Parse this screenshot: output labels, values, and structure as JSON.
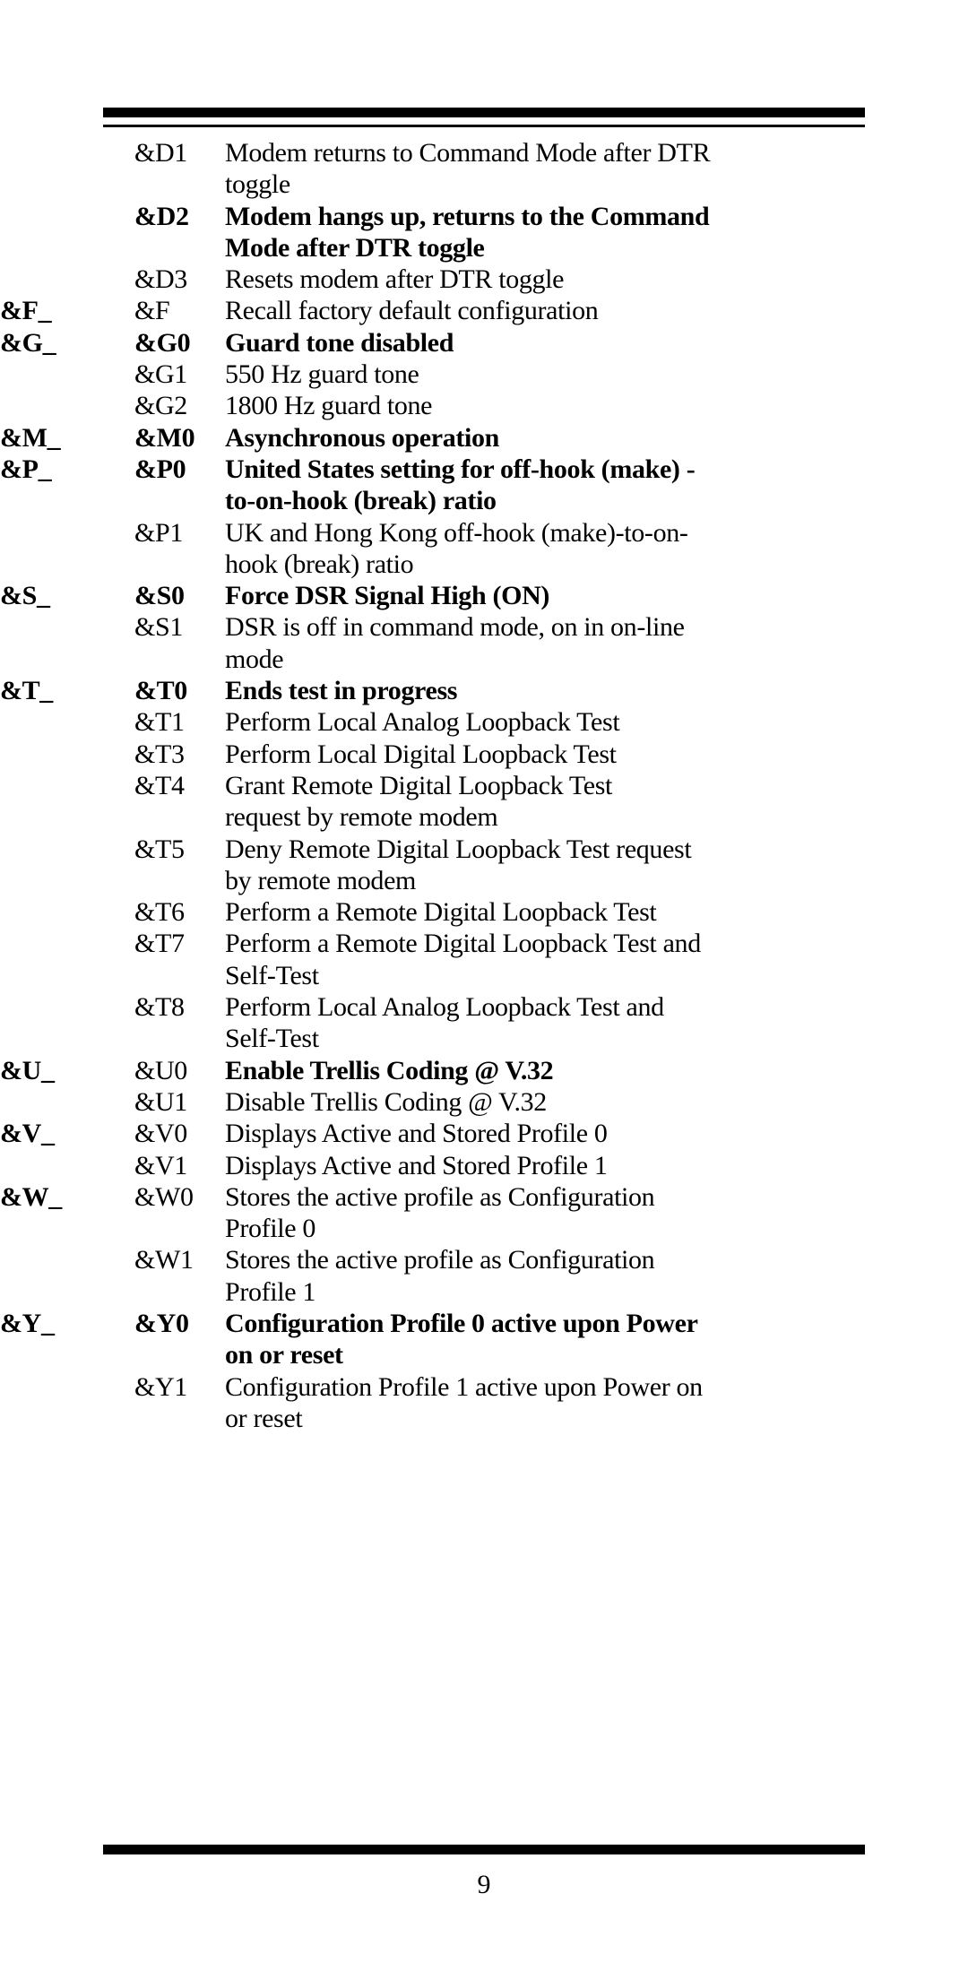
{
  "page": {
    "number": "9"
  },
  "rules": {
    "top": "top-divider",
    "bottom": "bottom-divider"
  },
  "table": {
    "rows": [
      {
        "group": "",
        "code": "&D1",
        "lines": [
          "Modem returns to Command Mode after DTR",
          "toggle"
        ],
        "bold": false,
        "group_start": false
      },
      {
        "group": "",
        "code": "&D2",
        "lines": [
          "Modem hangs up, returns to the Command",
          "Mode after  DTR toggle"
        ],
        "bold": true,
        "group_start": false
      },
      {
        "group": "",
        "code": "&D3",
        "lines": [
          "Resets modem after DTR toggle"
        ],
        "bold": false,
        "group_start": false
      },
      {
        "group": "&F_",
        "code": "&F",
        "lines": [
          "Recall factory default configuration"
        ],
        "bold": false,
        "group_start": true
      },
      {
        "group": "&G_",
        "code": "&G0",
        "lines": [
          "Guard tone disabled"
        ],
        "bold": true,
        "group_start": true
      },
      {
        "group": "",
        "code": "&G1",
        "lines": [
          "550 Hz guard tone"
        ],
        "bold": false,
        "group_start": false
      },
      {
        "group": "",
        "code": "&G2",
        "lines": [
          "1800 Hz guard tone"
        ],
        "bold": false,
        "group_start": false
      },
      {
        "group": "&M_",
        "code": "&M0",
        "lines": [
          "Asynchronous operation"
        ],
        "bold": true,
        "group_start": true
      },
      {
        "group": "&P_",
        "code": "&P0",
        "lines": [
          "United States setting for off-hook (make) -",
          "to-on-hook (break) ratio"
        ],
        "bold": true,
        "group_start": true
      },
      {
        "group": "",
        "code": "&P1",
        "lines": [
          "UK and Hong Kong off-hook (make)-to-on-",
          "hook (break) ratio"
        ],
        "bold": false,
        "group_start": false
      },
      {
        "group": "&S_",
        "code": "&S0",
        "lines": [
          "Force DSR Signal High (ON)"
        ],
        "bold": true,
        "group_start": true
      },
      {
        "group": "",
        "code": "&S1",
        "lines": [
          "DSR is off in command mode, on in on-line",
          "mode"
        ],
        "bold": false,
        "group_start": false
      },
      {
        "group": "&T_",
        "code": "&T0",
        "lines": [
          "Ends test in progress"
        ],
        "bold": true,
        "group_start": true
      },
      {
        "group": "",
        "code": "&T1",
        "lines": [
          "Perform Local Analog Loopback Test"
        ],
        "bold": false,
        "group_start": false
      },
      {
        "group": "",
        "code": "&T3",
        "lines": [
          "Perform Local Digital Loopback Test"
        ],
        "bold": false,
        "group_start": false
      },
      {
        "group": "",
        "code": "&T4",
        "lines": [
          "Grant Remote Digital Loopback Test",
          "request by remote modem"
        ],
        "bold": false,
        "group_start": false
      },
      {
        "group": "",
        "code": "&T5",
        "lines": [
          "Deny Remote Digital Loopback Test request",
          "by remote modem"
        ],
        "bold": false,
        "group_start": false
      },
      {
        "group": "",
        "code": "&T6",
        "lines": [
          "Perform a Remote Digital Loopback Test"
        ],
        "bold": false,
        "group_start": false
      },
      {
        "group": "",
        "code": "&T7",
        "lines": [
          "Perform a Remote Digital Loopback Test and",
          "Self-Test"
        ],
        "bold": false,
        "group_start": false
      },
      {
        "group": "",
        "code": "&T8",
        "lines": [
          "Perform Local Analog Loopback Test and",
          "Self-Test"
        ],
        "bold": false,
        "group_start": false
      },
      {
        "group": "&U_",
        "code": "&U0",
        "lines": [
          "Enable Trellis Coding @ V.32"
        ],
        "bold": true,
        "code_regular": true,
        "group_start": true
      },
      {
        "group": "",
        "code": "&U1",
        "lines": [
          "Disable Trellis Coding @ V.32"
        ],
        "bold": false,
        "group_start": false
      },
      {
        "group": "&V_",
        "code": "&V0",
        "lines": [
          "Displays Active and Stored Profile 0"
        ],
        "bold": false,
        "group_start": true
      },
      {
        "group": "",
        "code": "&V1",
        "lines": [
          "Displays Active and Stored Profile 1"
        ],
        "bold": false,
        "group_start": false
      },
      {
        "group": "&W_",
        "code": "&W0",
        "lines": [
          "Stores the active profile as Configuration",
          "Profile 0"
        ],
        "bold": false,
        "group_start": true
      },
      {
        "group": "",
        "code": "&W1",
        "lines": [
          "Stores the active profile as Configuration",
          "Profile 1"
        ],
        "bold": false,
        "group_start": false
      },
      {
        "group": "&Y_",
        "code": "&Y0",
        "lines": [
          "Configuration Profile 0 active upon Power",
          "on or reset"
        ],
        "bold": true,
        "group_start": true
      },
      {
        "group": "",
        "code": "&Y1",
        "lines": [
          "Configuration Profile 1 active upon Power on",
          "or reset"
        ],
        "bold": false,
        "group_start": false
      }
    ]
  }
}
